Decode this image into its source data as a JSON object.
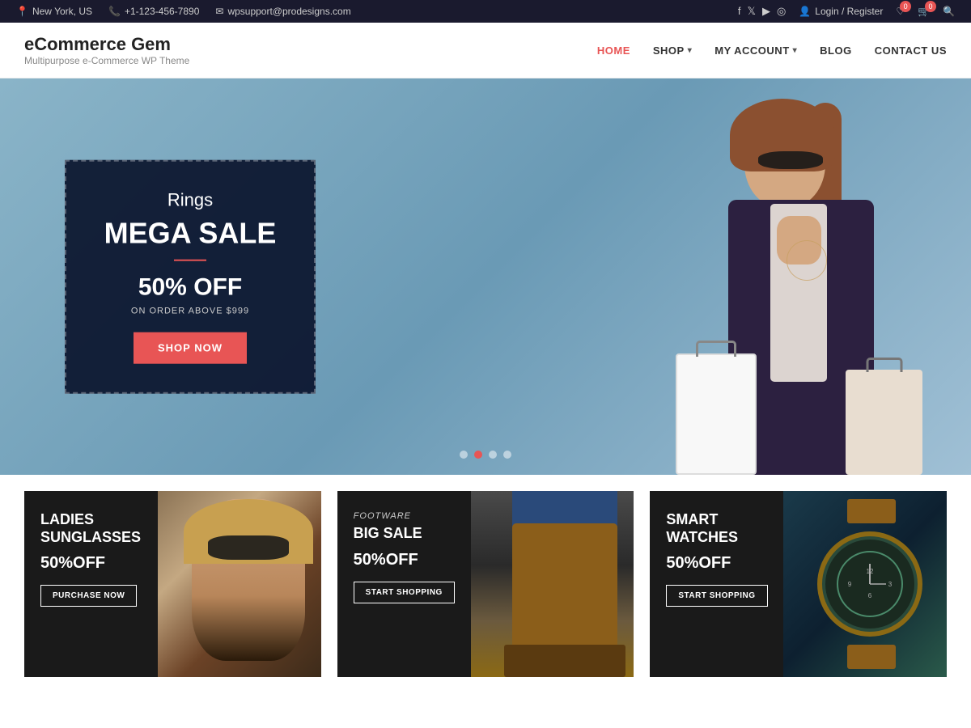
{
  "topbar": {
    "location": "New York, US",
    "phone": "+1-123-456-7890",
    "email": "wpsupport@prodesigns.com",
    "social": [
      "f",
      "t",
      "▶",
      "◎"
    ],
    "login": "Login / Register",
    "wishlist_count": "0",
    "cart_count": "0"
  },
  "header": {
    "logo_title": "eCommerce Gem",
    "logo_sub": "Multipurpose e-Commerce WP Theme",
    "nav": [
      {
        "label": "HOME",
        "active": true,
        "has_dropdown": false
      },
      {
        "label": "SHOP",
        "active": false,
        "has_dropdown": true
      },
      {
        "label": "MY ACCOUNT",
        "active": false,
        "has_dropdown": true
      },
      {
        "label": "BLOG",
        "active": false,
        "has_dropdown": false
      },
      {
        "label": "CONTACT US",
        "active": false,
        "has_dropdown": false
      }
    ]
  },
  "hero": {
    "subtitle": "Rings",
    "title": "MEGA SALE",
    "divider": true,
    "discount": "50% OFF",
    "condition": "ON ORDER ABOVE $999",
    "button_label": "SHOP NOW",
    "dots": [
      1,
      2,
      3,
      4
    ],
    "active_dot": 2
  },
  "promo_cards": [
    {
      "label": "",
      "title": "LADIES\nSUNGLASSES",
      "discount": "50%OFF",
      "button_label": "PURCHASE NOW"
    },
    {
      "label": "FOOTWARE",
      "title": "BIG SALE",
      "discount": "50%OFF",
      "button_label": "START SHOPPING"
    },
    {
      "label": "",
      "title": "SMART\nWATCHES",
      "discount": "50%OFF",
      "button_label": "START SHOPPING"
    }
  ],
  "colors": {
    "accent": "#e85555",
    "dark_bg": "#1a1a2e",
    "hero_bg": "#7ea8c4",
    "card_bg": "#1a1a1a"
  }
}
